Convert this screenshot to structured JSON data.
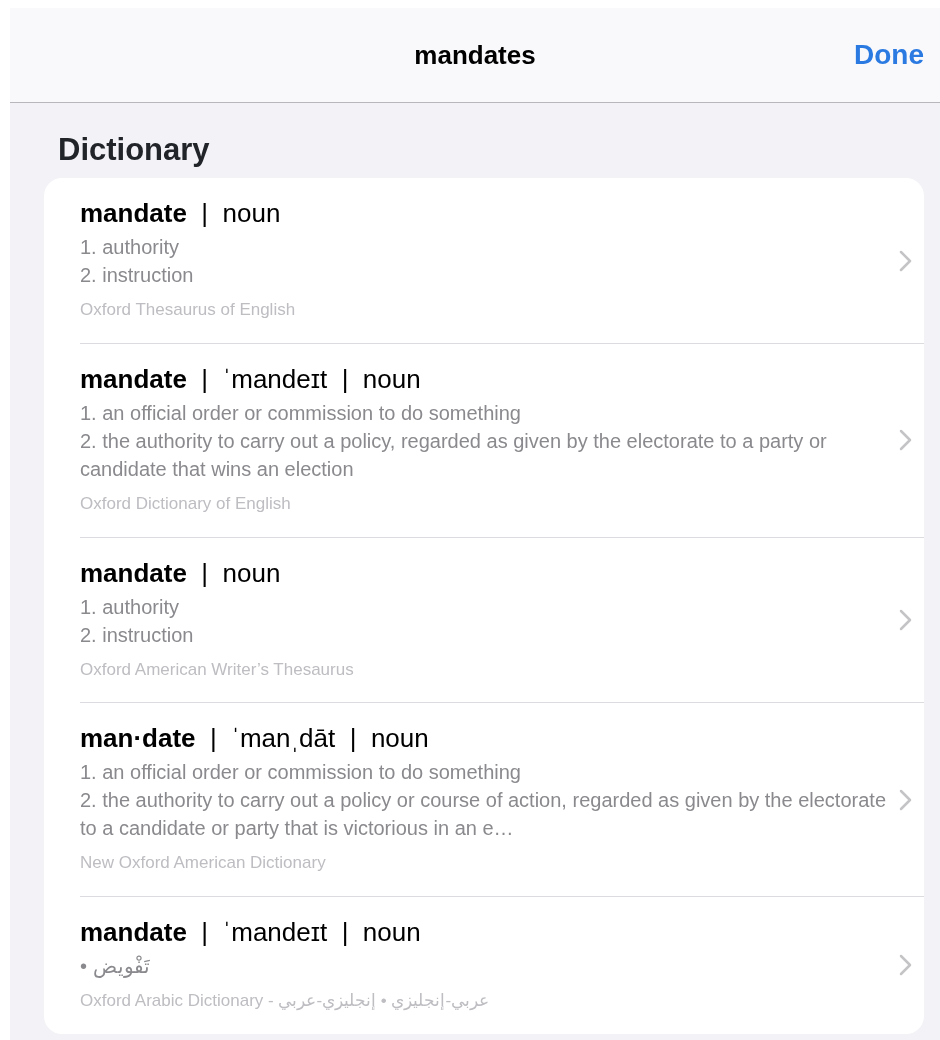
{
  "nav": {
    "title": "mandates",
    "done": "Done"
  },
  "section_title": "Dictionary",
  "entries": [
    {
      "title": "**mandate**  |  noun",
      "definitions": [
        "1. authority",
        "2. instruction"
      ],
      "source": "Oxford Thesaurus of English"
    },
    {
      "title": "**mandate**  |  ˈmandeɪt  |  noun",
      "definitions": [
        "1. an official order or commission to do something",
        "2. the authority to carry out a policy, regarded as given by the electorate to a party or candidate that wins an election"
      ],
      "source": "Oxford Dictionary of English"
    },
    {
      "title": "**mandate**  |  noun",
      "definitions": [
        "1. authority",
        "2. instruction"
      ],
      "source": "Oxford American Writer’s Thesaurus"
    },
    {
      "title": "**man·date**  |  ˈmanˌdāt  |  noun",
      "definitions": [
        "1. an official order or commission to do something",
        "2. the authority to carry out a policy or course of action, regarded as given by the electorate to a candidate or party that is victorious in an e…"
      ],
      "source": "New Oxford American Dictionary"
    },
    {
      "title": "**mandate**  |  ˈmandeɪt  |  noun",
      "definitions": [
        "• تَفْويض"
      ],
      "source": "Oxford Arabic Dictionary - عربي-إنجليزي • إنجليزي-عربي"
    }
  ]
}
